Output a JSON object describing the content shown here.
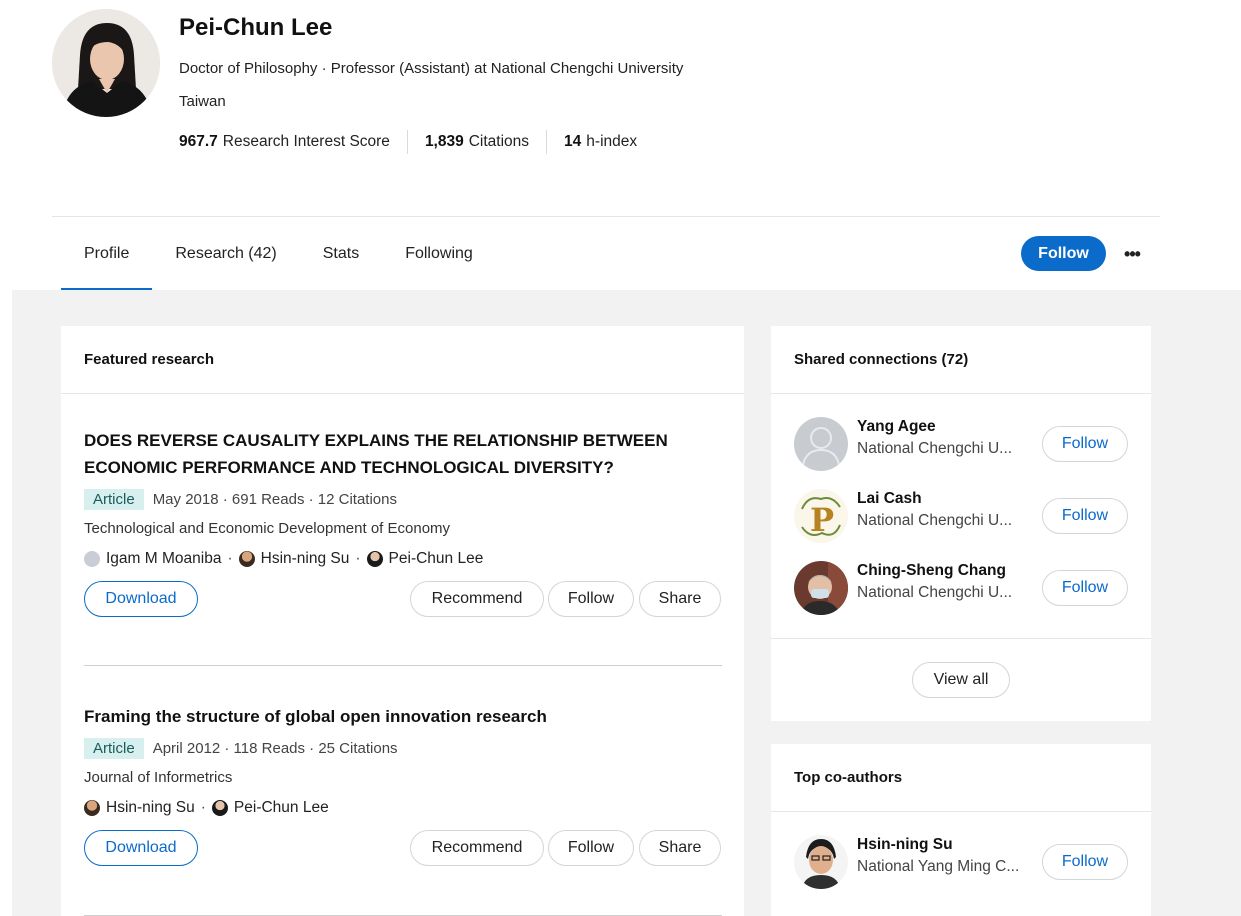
{
  "profile": {
    "name": "Pei-Chun Lee",
    "degree_line": "Doctor of Philosophy · Professor (Assistant) at National Chengchi University",
    "country": "Taiwan",
    "metrics": [
      {
        "value": "967.7",
        "label": "Research Interest Score"
      },
      {
        "value": "1,839",
        "label": "Citations"
      },
      {
        "value": "14",
        "label": "h-index"
      }
    ]
  },
  "tabs": [
    {
      "label": "Profile",
      "active": true
    },
    {
      "label": "Research (42)",
      "active": false
    },
    {
      "label": "Stats",
      "active": false
    },
    {
      "label": "Following",
      "active": false
    }
  ],
  "header_actions": {
    "follow_label": "Follow",
    "more_icon": "more-horizontal-icon",
    "more_glyph": "•••"
  },
  "colors": {
    "accent": "#0b6bcb",
    "badge_bg": "#d7f0ef",
    "page_bg": "#f2f2f2"
  },
  "featured": {
    "title": "Featured research",
    "publications": [
      {
        "title": "DOES REVERSE CAUSALITY EXPLAINS THE RELATIONSHIP BETWEEN ECONOMIC PERFORMANCE AND TECHNOLOGICAL DIVERSITY?",
        "type": "Article",
        "meta": "May 2018 · 691 Reads · 12 Citations",
        "journal": "Technological and Economic Development of Economy",
        "authors": [
          "Igam M Moaniba",
          "Hsin-ning Su",
          "Pei-Chun Lee"
        ],
        "download": "Download",
        "recommend": "Recommend",
        "follow": "Follow",
        "share": "Share"
      },
      {
        "title": "Framing the structure of global open innovation research",
        "type": "Article",
        "meta": "April 2012 · 118 Reads · 25 Citations",
        "journal": "Journal of Informetrics",
        "authors": [
          "Hsin-ning Su",
          "Pei-Chun Lee"
        ],
        "download": "Download",
        "recommend": "Recommend",
        "follow": "Follow",
        "share": "Share"
      }
    ]
  },
  "connections": {
    "title": "Shared connections (72)",
    "people": [
      {
        "name": "Yang Agee",
        "affiliation": "National Chengchi U...",
        "follow": "Follow"
      },
      {
        "name": "Lai Cash",
        "affiliation": "National Chengchi U...",
        "follow": "Follow"
      },
      {
        "name": "Ching-Sheng Chang",
        "affiliation": "National Chengchi U...",
        "follow": "Follow"
      }
    ],
    "view_all": "View all"
  },
  "coauthors": {
    "title": "Top co-authors",
    "people": [
      {
        "name": "Hsin-ning Su",
        "affiliation": "National Yang Ming C...",
        "follow": "Follow"
      }
    ]
  }
}
